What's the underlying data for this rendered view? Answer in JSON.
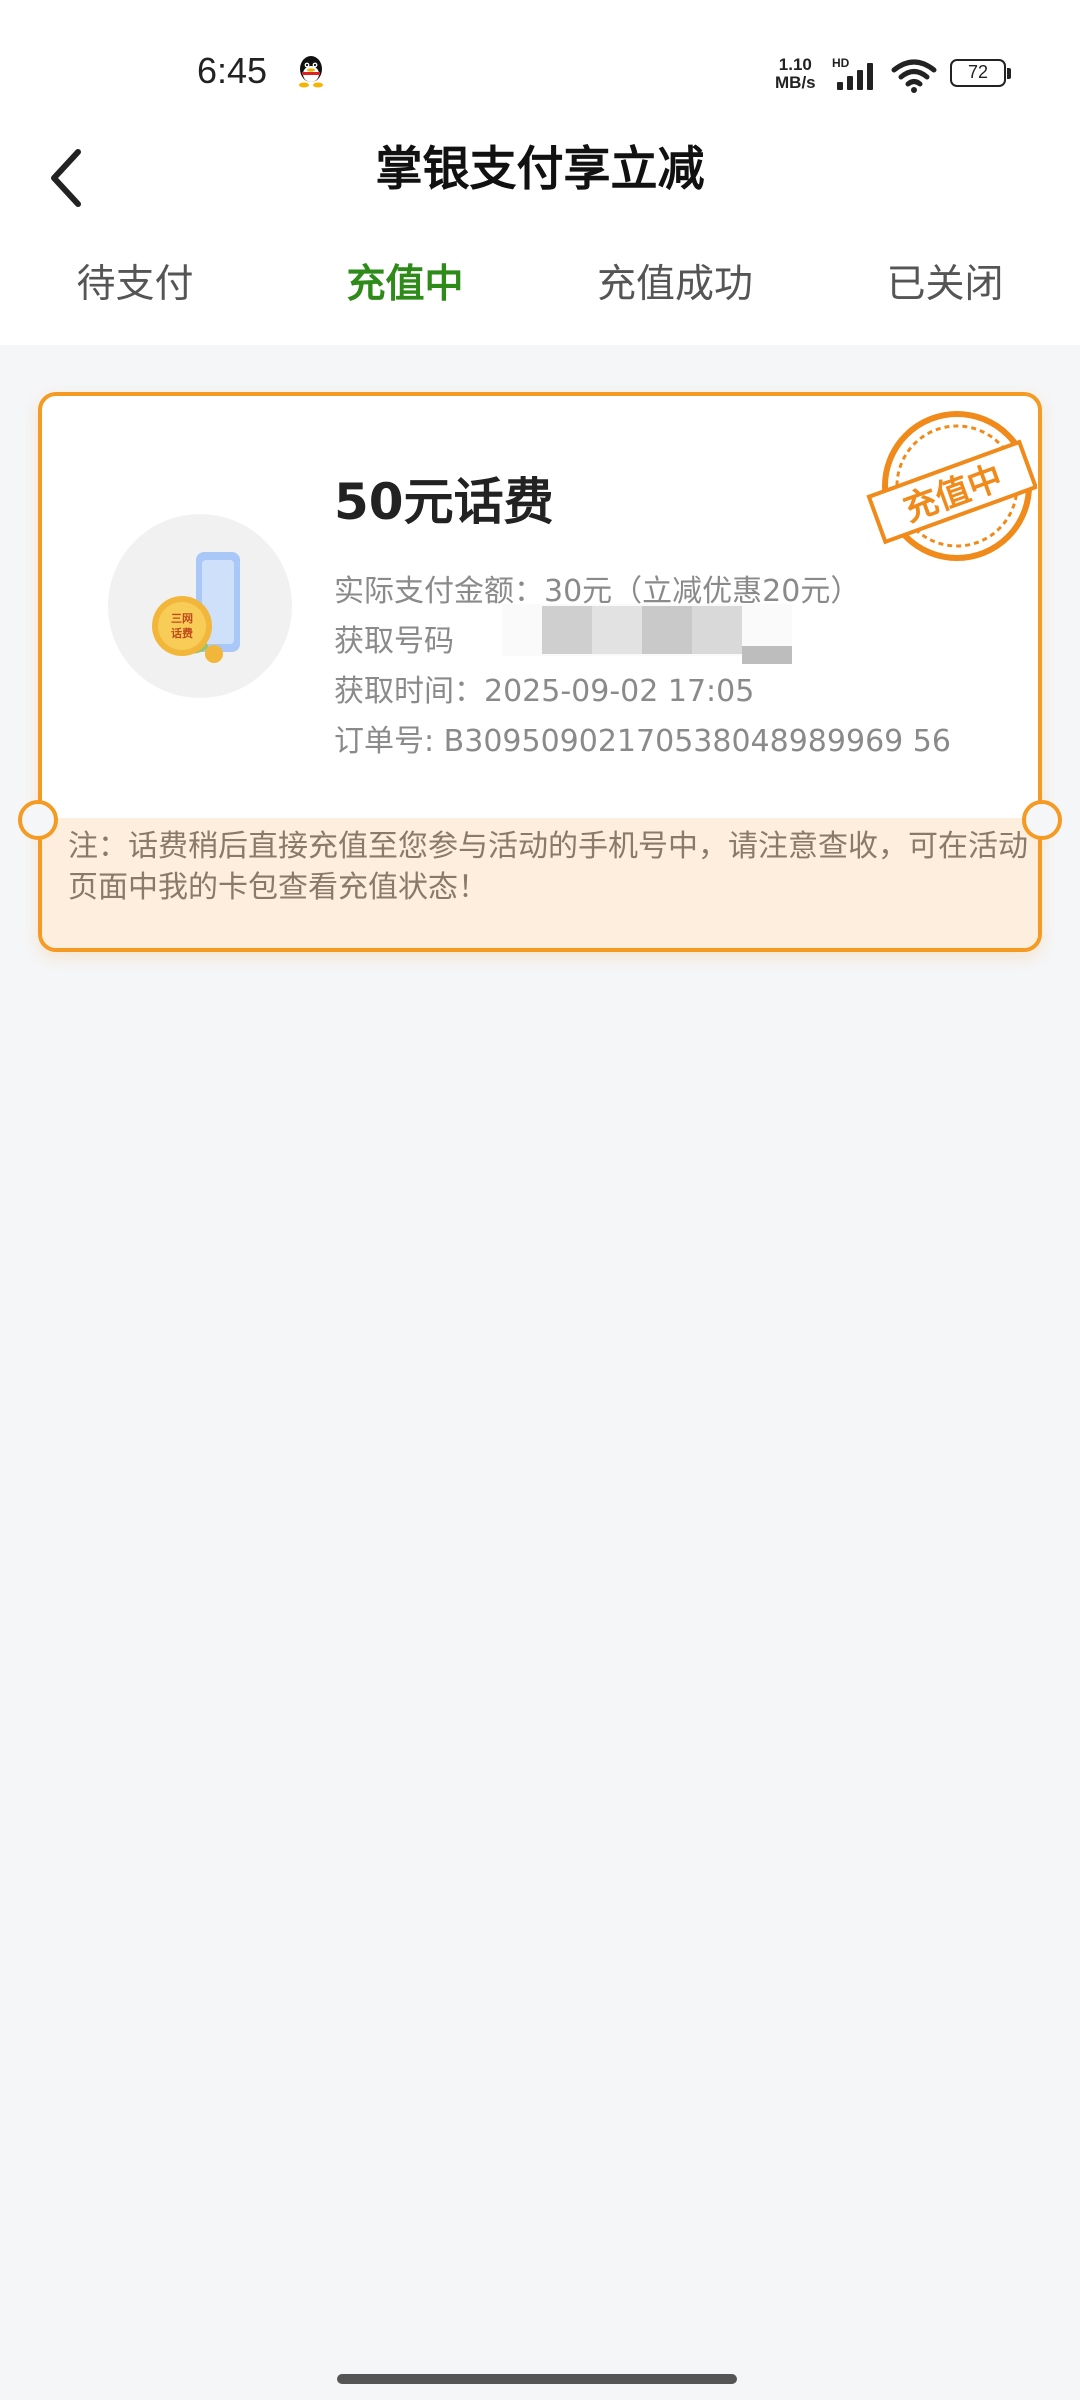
{
  "status_bar": {
    "time": "6:45",
    "net_speed_value": "1.10",
    "net_speed_unit": "MB/s",
    "hd": "HD",
    "battery": "72"
  },
  "header": {
    "title": "掌银支付享立减"
  },
  "tabs": [
    {
      "label": "待支付",
      "active": false
    },
    {
      "label": "充值中",
      "active": true
    },
    {
      "label": "充值成功",
      "active": false
    },
    {
      "label": "已关闭",
      "active": false
    }
  ],
  "order": {
    "product_name": "50元话费",
    "paid_label": "实际支付金额：",
    "paid_value": "30元（立减优惠20元）",
    "phone_label": "获取号码",
    "time_label": "获取时间：",
    "time_value": "2025-09-02 17:05",
    "order_label": "订单号: ",
    "order_value": "B30950902170538048989969 56",
    "status_stamp": "充值中",
    "icon_text": "三网话费",
    "note": "注：话费稍后直接充值至您参与活动的手机号中，请注意查收，可在活动页面中我的卡包查看充值状态！"
  },
  "colors": {
    "accent_green": "#2e8b1a",
    "card_border": "#f59a23",
    "note_bg": "#fdeede",
    "page_bg": "#f5f6f8"
  }
}
